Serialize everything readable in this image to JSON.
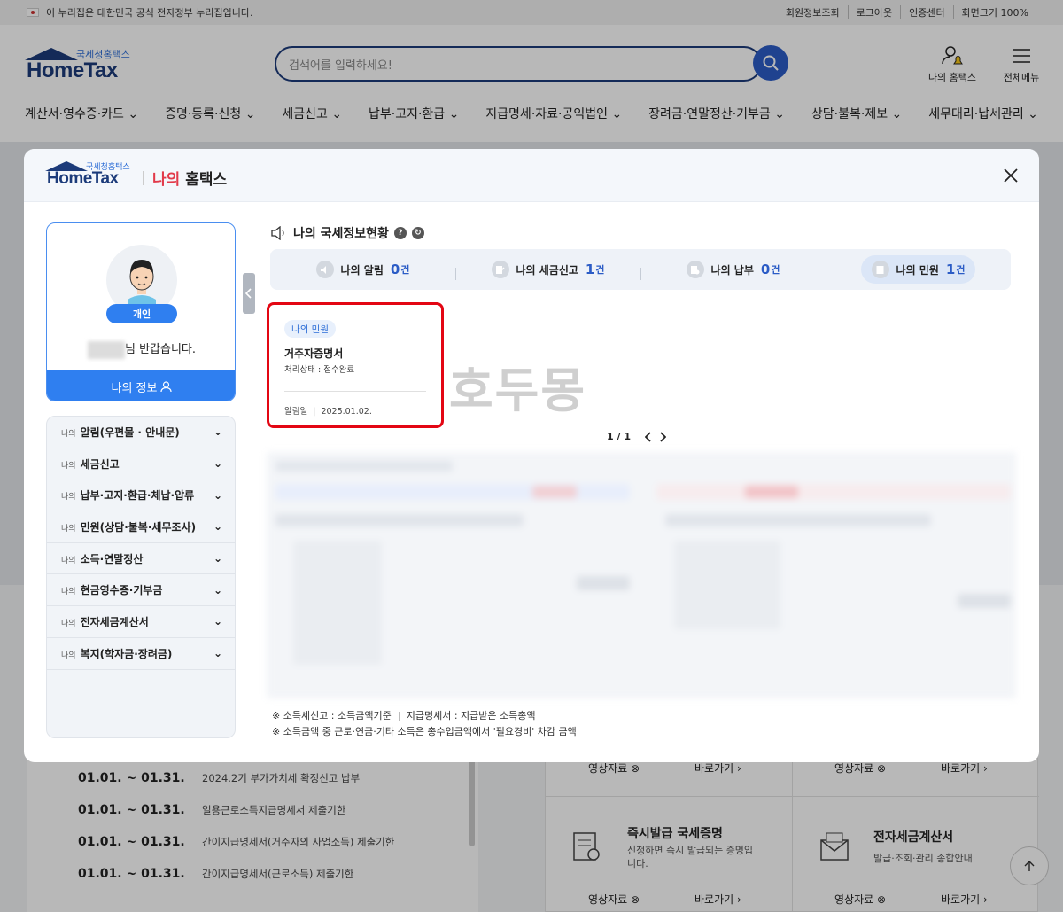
{
  "gov_banner": {
    "text": "이 누리집은 대한민국 공식 전자정부 누리집입니다.",
    "links": [
      "회원정보조회",
      "로그아웃",
      "인증센터",
      "화면크기 100%"
    ]
  },
  "brand": {
    "sub": "국세청홈택스",
    "main": "HomeTax"
  },
  "search": {
    "placeholder": "검색어를 입력하세요!"
  },
  "header_icons": {
    "my_hometax": "나의 홈택스",
    "all_menu": "전체메뉴"
  },
  "nav": [
    "계산서·영수증·카드",
    "증명·등록·신청",
    "세금신고",
    "납부·고지·환급",
    "지급명세·자료·공익법인",
    "장려금·연말정산·기부금",
    "상담·불복·제보",
    "세무대리·납세관리"
  ],
  "modal": {
    "title_red": "나의",
    "title_rest": "홈택스",
    "profile": {
      "badge": "개인",
      "greeting": "님 반갑습니다.",
      "my_info": "나의 정보"
    },
    "side_menu": [
      {
        "pre": "나의",
        "label": "알림(우편물 · 안내문)"
      },
      {
        "pre": "나의",
        "label": "세금신고"
      },
      {
        "pre": "나의",
        "label": "납부·고지·환급·체납·압류"
      },
      {
        "pre": "나의",
        "label": "민원(상담·불복·세무조사)"
      },
      {
        "pre": "나의",
        "label": "소득·연말정산"
      },
      {
        "pre": "나의",
        "label": "현금영수증·기부금"
      },
      {
        "pre": "나의",
        "label": "전자세금계산서"
      },
      {
        "pre": "나의",
        "label": "복지(학자금·장려금)"
      }
    ],
    "section_title": "나의 국세정보현황",
    "stats": [
      {
        "label": "나의 알림",
        "count": "0",
        "unit": "건"
      },
      {
        "label": "나의 세금신고",
        "count": "1",
        "unit": "건"
      },
      {
        "label": "나의 납부",
        "count": "0",
        "unit": "건"
      },
      {
        "label": "나의 민원",
        "count": "1",
        "unit": "건"
      }
    ],
    "card": {
      "tag": "나의 민원",
      "title": "거주자증명서",
      "status": "처리상태 : 접수완료",
      "date_label": "알림일",
      "date": "2025.01.02."
    },
    "watermark": "호두몽",
    "pager": {
      "text": "1 / 1"
    },
    "notes": {
      "line1a": "※ 소득세신고 : 소득금액기준",
      "line1b": "지급명세서 : 지급받은 소득총액",
      "line2": "※ 소득금액 중 근로·연금·기타 소득은 총수입금액에서 '필요경비' 차감 금액"
    }
  },
  "background": {
    "schedule": [
      {
        "date": "01.01. ~ 01.31.",
        "text": "2024.2기 부가가치세 확정신고 납부"
      },
      {
        "date": "01.01. ~ 01.31.",
        "text": "일용근로소득지급명세서 제출기한"
      },
      {
        "date": "01.01. ~ 01.31.",
        "text": "간이지급명세서(거주자의 사업소득) 제출기한"
      },
      {
        "date": "01.01. ~ 01.31.",
        "text": "간이지급명세서(근로소득) 제출기한"
      }
    ],
    "services": [
      {
        "title": "즉시발급 국세증명",
        "desc": "신청하면 즉시 발급되는 증명입니다."
      },
      {
        "title": "전자세금계산서",
        "desc": "발급·조회·관리 종합안내"
      }
    ],
    "video_label": "영상자료",
    "goto_label": "바로가기"
  }
}
